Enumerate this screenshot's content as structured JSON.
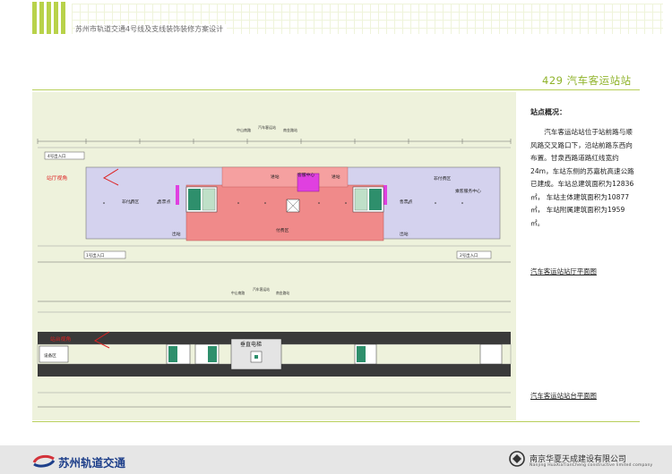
{
  "header": {
    "title": "苏州市轨道交通4号线及支线装饰装修方案设计"
  },
  "section": {
    "title": "429 汽车客运站站"
  },
  "info": {
    "heading": "站点概况：",
    "body": "汽车客运站站位于站前路与顺风路交叉路口下，沿站前路东西向布置。甘泉西路道路红线宽约24m，车站东侧的苏嘉杭高速公路已建成。车站总建筑面积为12836㎡， 车站主体建筑面积为10877㎡， 车站附属建筑面积为1959㎡。"
  },
  "captions": {
    "concourse": "汽车客运站站厅平面图",
    "platform": "汽车客运站站台平面图"
  },
  "concourse_plan": {
    "road_labels": [
      "中山南路",
      "汽车客运站",
      "南金路站"
    ],
    "entrances": [
      "4号出入口",
      "1号出入口",
      "2号出入口"
    ],
    "view_label": "站厅视角",
    "zones": [
      "非付费区",
      "售票点",
      "进站",
      "客服中心",
      "进站",
      "非付费区",
      "售票点",
      "出站",
      "付费区",
      "出站",
      "乘客服务中心"
    ]
  },
  "platform_plan": {
    "road_labels": [
      "中山南路",
      "汽车客运站",
      "南金路站"
    ],
    "view_label": "站台视角",
    "elevator_label": "垂直电梯",
    "side_label": "设备区"
  },
  "footer": {
    "left_logo": "苏州轨道交通",
    "right_logo": "南京华夏天成建设有限公司",
    "right_logo_sub": "Nanjing HuaXiaTianCheng constructive limited company"
  },
  "colors": {
    "accent": "#8fb32a",
    "paid_zone": "#f08a8a",
    "unpaid_zone": "#d4d2ee",
    "service": "#e040e0",
    "stairs": "#2e8f6c",
    "brand_blue": "#1e3f8a",
    "brand_red": "#d3323a"
  }
}
